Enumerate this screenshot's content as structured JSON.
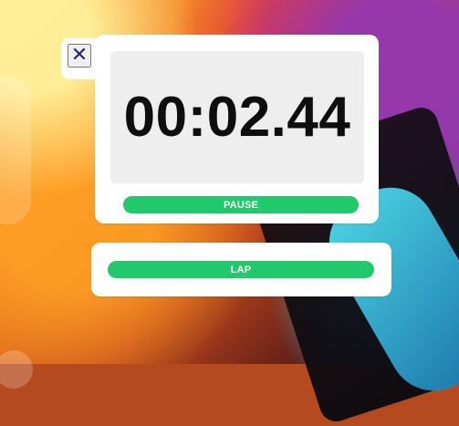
{
  "timer": {
    "display": "00:02.44"
  },
  "controls": {
    "close_icon": "close-icon",
    "pause_label": "PAUSE",
    "lap_label": "LAP"
  },
  "colors": {
    "card": "#ffffff",
    "panel": "#eeeeee",
    "accent": "#22c96c",
    "close": "#1e2a6d",
    "text": "#0e0e0e"
  }
}
